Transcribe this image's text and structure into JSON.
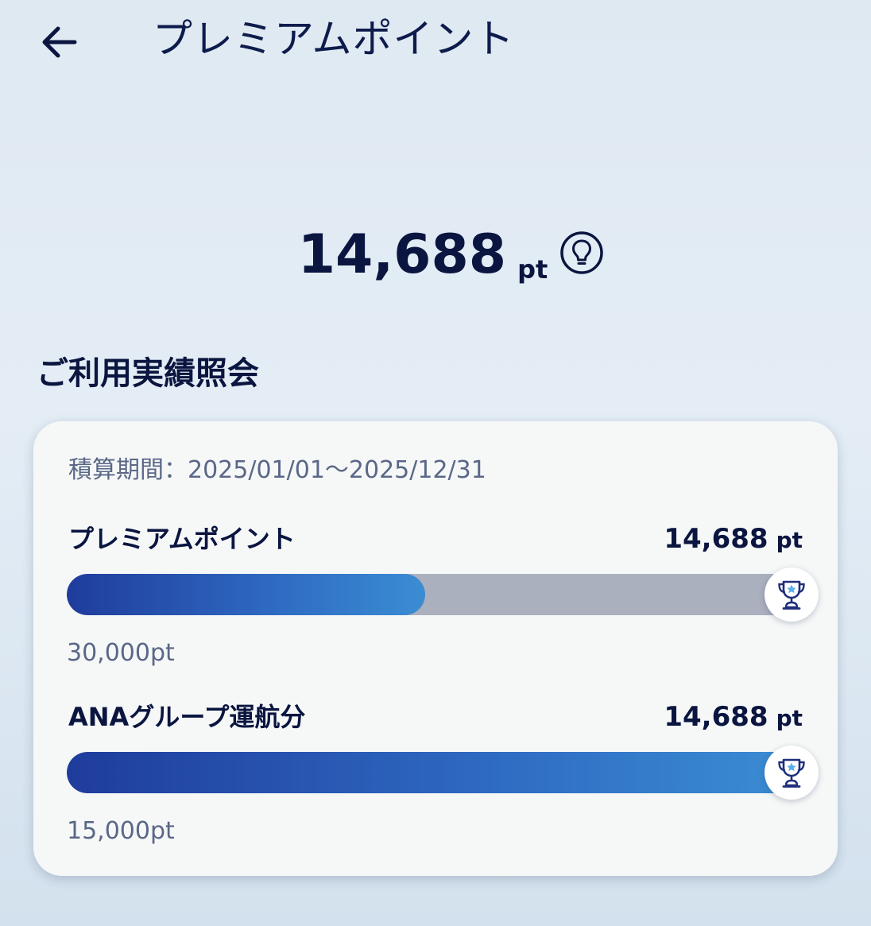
{
  "header": {
    "title": "プレミアムポイント",
    "back_icon": "arrow-left-icon"
  },
  "summary": {
    "total_value": "14,688",
    "unit": "pt",
    "info_icon": "lightbulb-icon"
  },
  "section": {
    "title": "ご利用実績照会"
  },
  "card": {
    "period": "積算期間：2025/01/01〜2025/12/31",
    "rows": [
      {
        "label": "プレミアムポイント",
        "value": "14,688",
        "unit": "pt",
        "target": "30,000pt",
        "progress": 0.49,
        "icon": "trophy-icon"
      },
      {
        "label": "ANAグループ運航分",
        "value": "14,688",
        "unit": "pt",
        "target": "15,000pt",
        "progress": 1.0,
        "icon": "trophy-icon"
      }
    ]
  },
  "colors": {
    "text_primary": "#0a1540",
    "text_secondary": "#5a6787",
    "bar_start": "#1f3c9c",
    "bar_end": "#3b8dd3",
    "track": "#abb0bf",
    "trophy_star": "#5ab0e8"
  }
}
